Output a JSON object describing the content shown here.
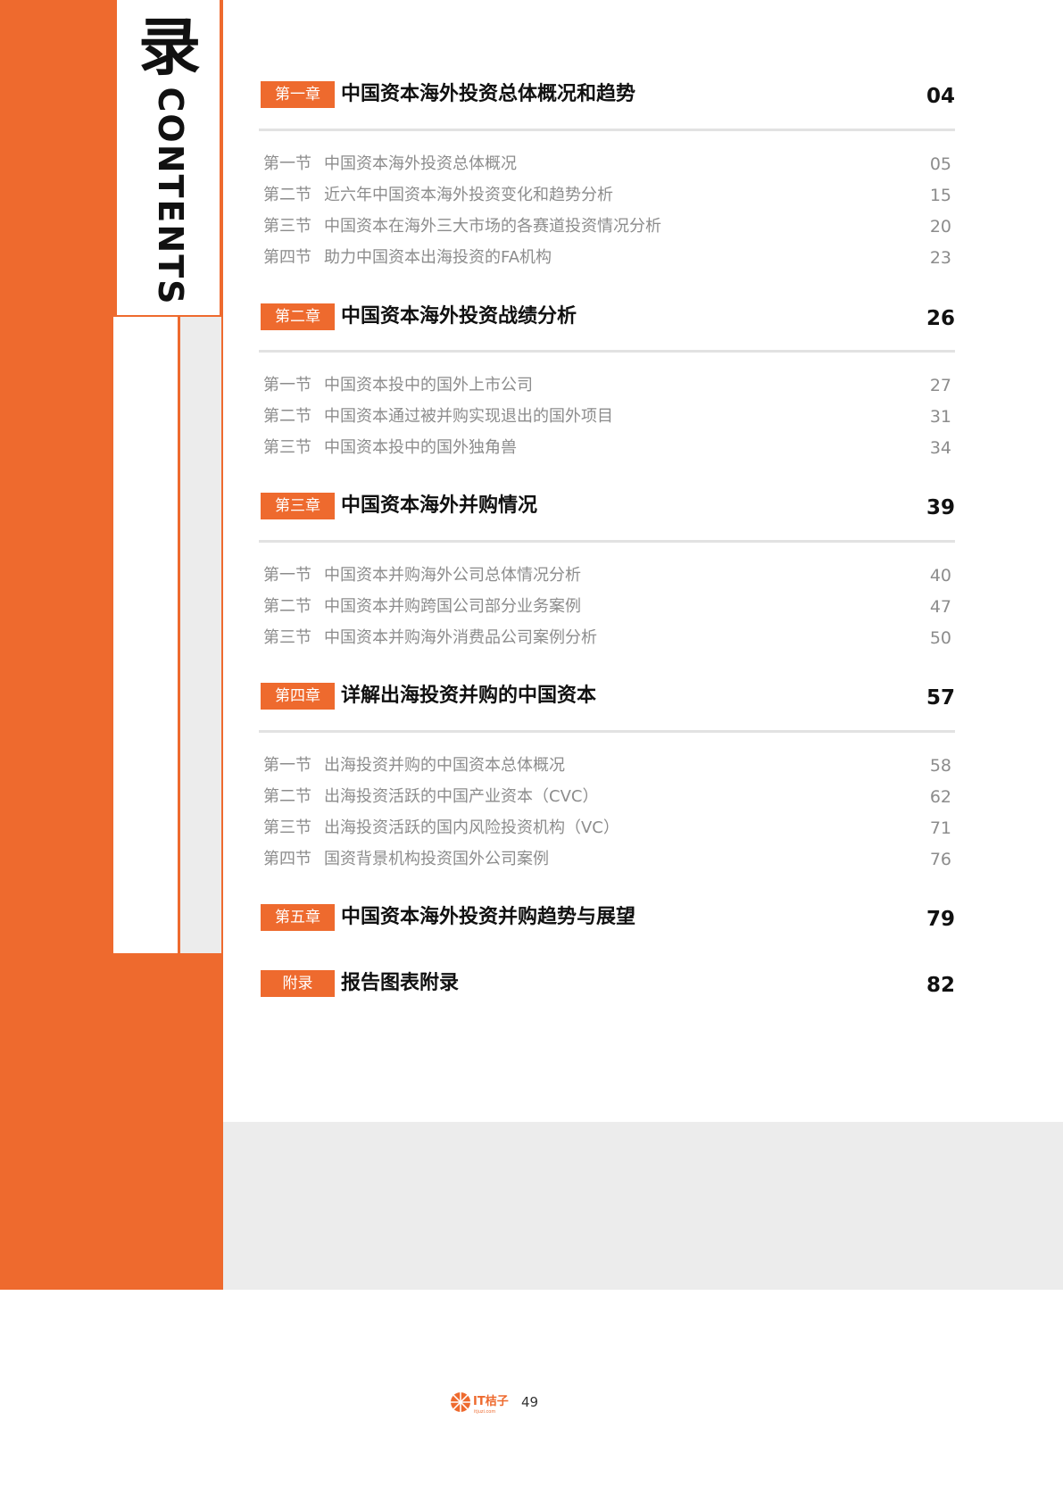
{
  "header": {
    "title_char": "录",
    "title_en": "CONTENTS"
  },
  "chapters": [
    {
      "tag": "第一章",
      "title": "中国资本海外投资总体概况和趋势",
      "page": "04",
      "sections": [
        {
          "num": "第一节",
          "title": "中国资本海外投资总体概况",
          "page": "05"
        },
        {
          "num": "第二节",
          "title": "近六年中国资本海外投资变化和趋势分析",
          "page": "15"
        },
        {
          "num": "第三节",
          "title": "中国资本在海外三大市场的各赛道投资情况分析",
          "page": "20"
        },
        {
          "num": "第四节",
          "title": "助力中国资本出海投资的FA机构",
          "page": "23"
        }
      ]
    },
    {
      "tag": "第二章",
      "title": "中国资本海外投资战绩分析",
      "page": "26",
      "sections": [
        {
          "num": "第一节",
          "title": "中国资本投中的国外上市公司",
          "page": "27"
        },
        {
          "num": "第二节",
          "title": "中国资本通过被并购实现退出的国外项目",
          "page": "31"
        },
        {
          "num": "第三节",
          "title": "中国资本投中的国外独角兽",
          "page": "34"
        }
      ]
    },
    {
      "tag": "第三章",
      "title": "中国资本海外并购情况",
      "page": "39",
      "sections": [
        {
          "num": "第一节",
          "title": "中国资本并购海外公司总体情况分析",
          "page": "40"
        },
        {
          "num": "第二节",
          "title": "中国资本并购跨国公司部分业务案例",
          "page": "47"
        },
        {
          "num": "第三节",
          "title": "中国资本并购海外消费品公司案例分析",
          "page": "50"
        }
      ]
    },
    {
      "tag": "第四章",
      "title": "详解出海投资并购的中国资本",
      "page": "57",
      "sections": [
        {
          "num": "第一节",
          "title": "出海投资并购的中国资本总体概况",
          "page": "58"
        },
        {
          "num": "第二节",
          "title": "出海投资活跃的中国产业资本（CVC）",
          "page": "62"
        },
        {
          "num": "第三节",
          "title": "出海投资活跃的国内风险投资机构（VC）",
          "page": "71"
        },
        {
          "num": "第四节",
          "title": "国资背景机构投资国外公司案例",
          "page": "76"
        }
      ]
    },
    {
      "tag": "第五章",
      "title": "中国资本海外投资并购趋势与展望",
      "page": "79",
      "sections": []
    },
    {
      "tag": "附录",
      "title": "报告图表附录",
      "page": "82",
      "sections": []
    }
  ],
  "footer": {
    "logo_text": "IT桔子",
    "logo_sub": "itjuzi.com",
    "page_number": "49"
  },
  "colors": {
    "accent": "#ee6a2e",
    "grey": "#ececec",
    "section_text": "#8c8c8c"
  }
}
